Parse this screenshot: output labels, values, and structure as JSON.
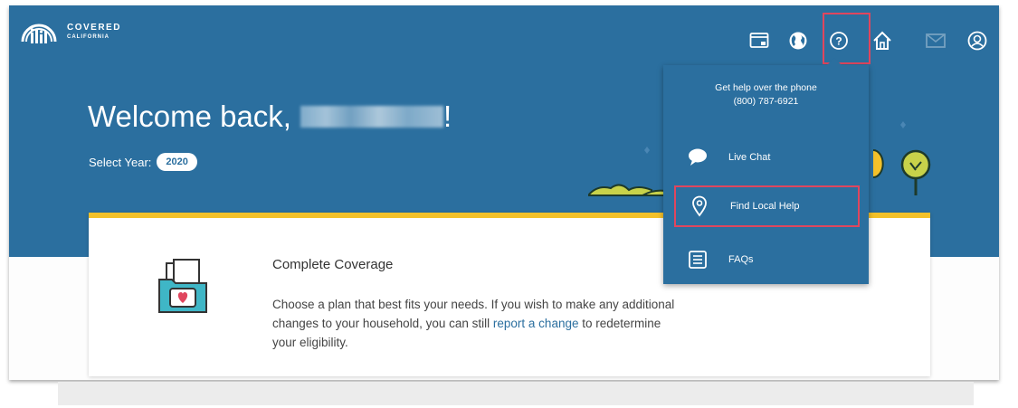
{
  "brand": {
    "line1": "COVERED",
    "line2": "CALIFORNIA"
  },
  "header_icons": [
    "window-icon",
    "globe-icon",
    "help-icon",
    "home-icon",
    "mail-icon",
    "user-icon"
  ],
  "welcome": {
    "prefix": "Welcome back,",
    "suffix": "!"
  },
  "year": {
    "label": "Select Year:",
    "value": "2020"
  },
  "card": {
    "title": "Complete Coverage",
    "body_before": "Choose a plan that best fits your needs. If you wish to make any additional changes to your household, you can still ",
    "link": "report a change",
    "body_after": " to redetermine your eligibility."
  },
  "help_menu": {
    "phone_line1": "Get help over the phone",
    "phone_line2": "(800) 787-6921",
    "items": [
      {
        "label": "Live Chat",
        "icon": "chat-icon"
      },
      {
        "label": "Find Local Help",
        "icon": "location-pin-icon"
      },
      {
        "label": "FAQs",
        "icon": "list-icon"
      }
    ]
  },
  "colors": {
    "primary": "#2b6f9f",
    "accent": "#f3c12a",
    "highlight": "#e0465e",
    "card_icon": "#3fb6c6"
  }
}
